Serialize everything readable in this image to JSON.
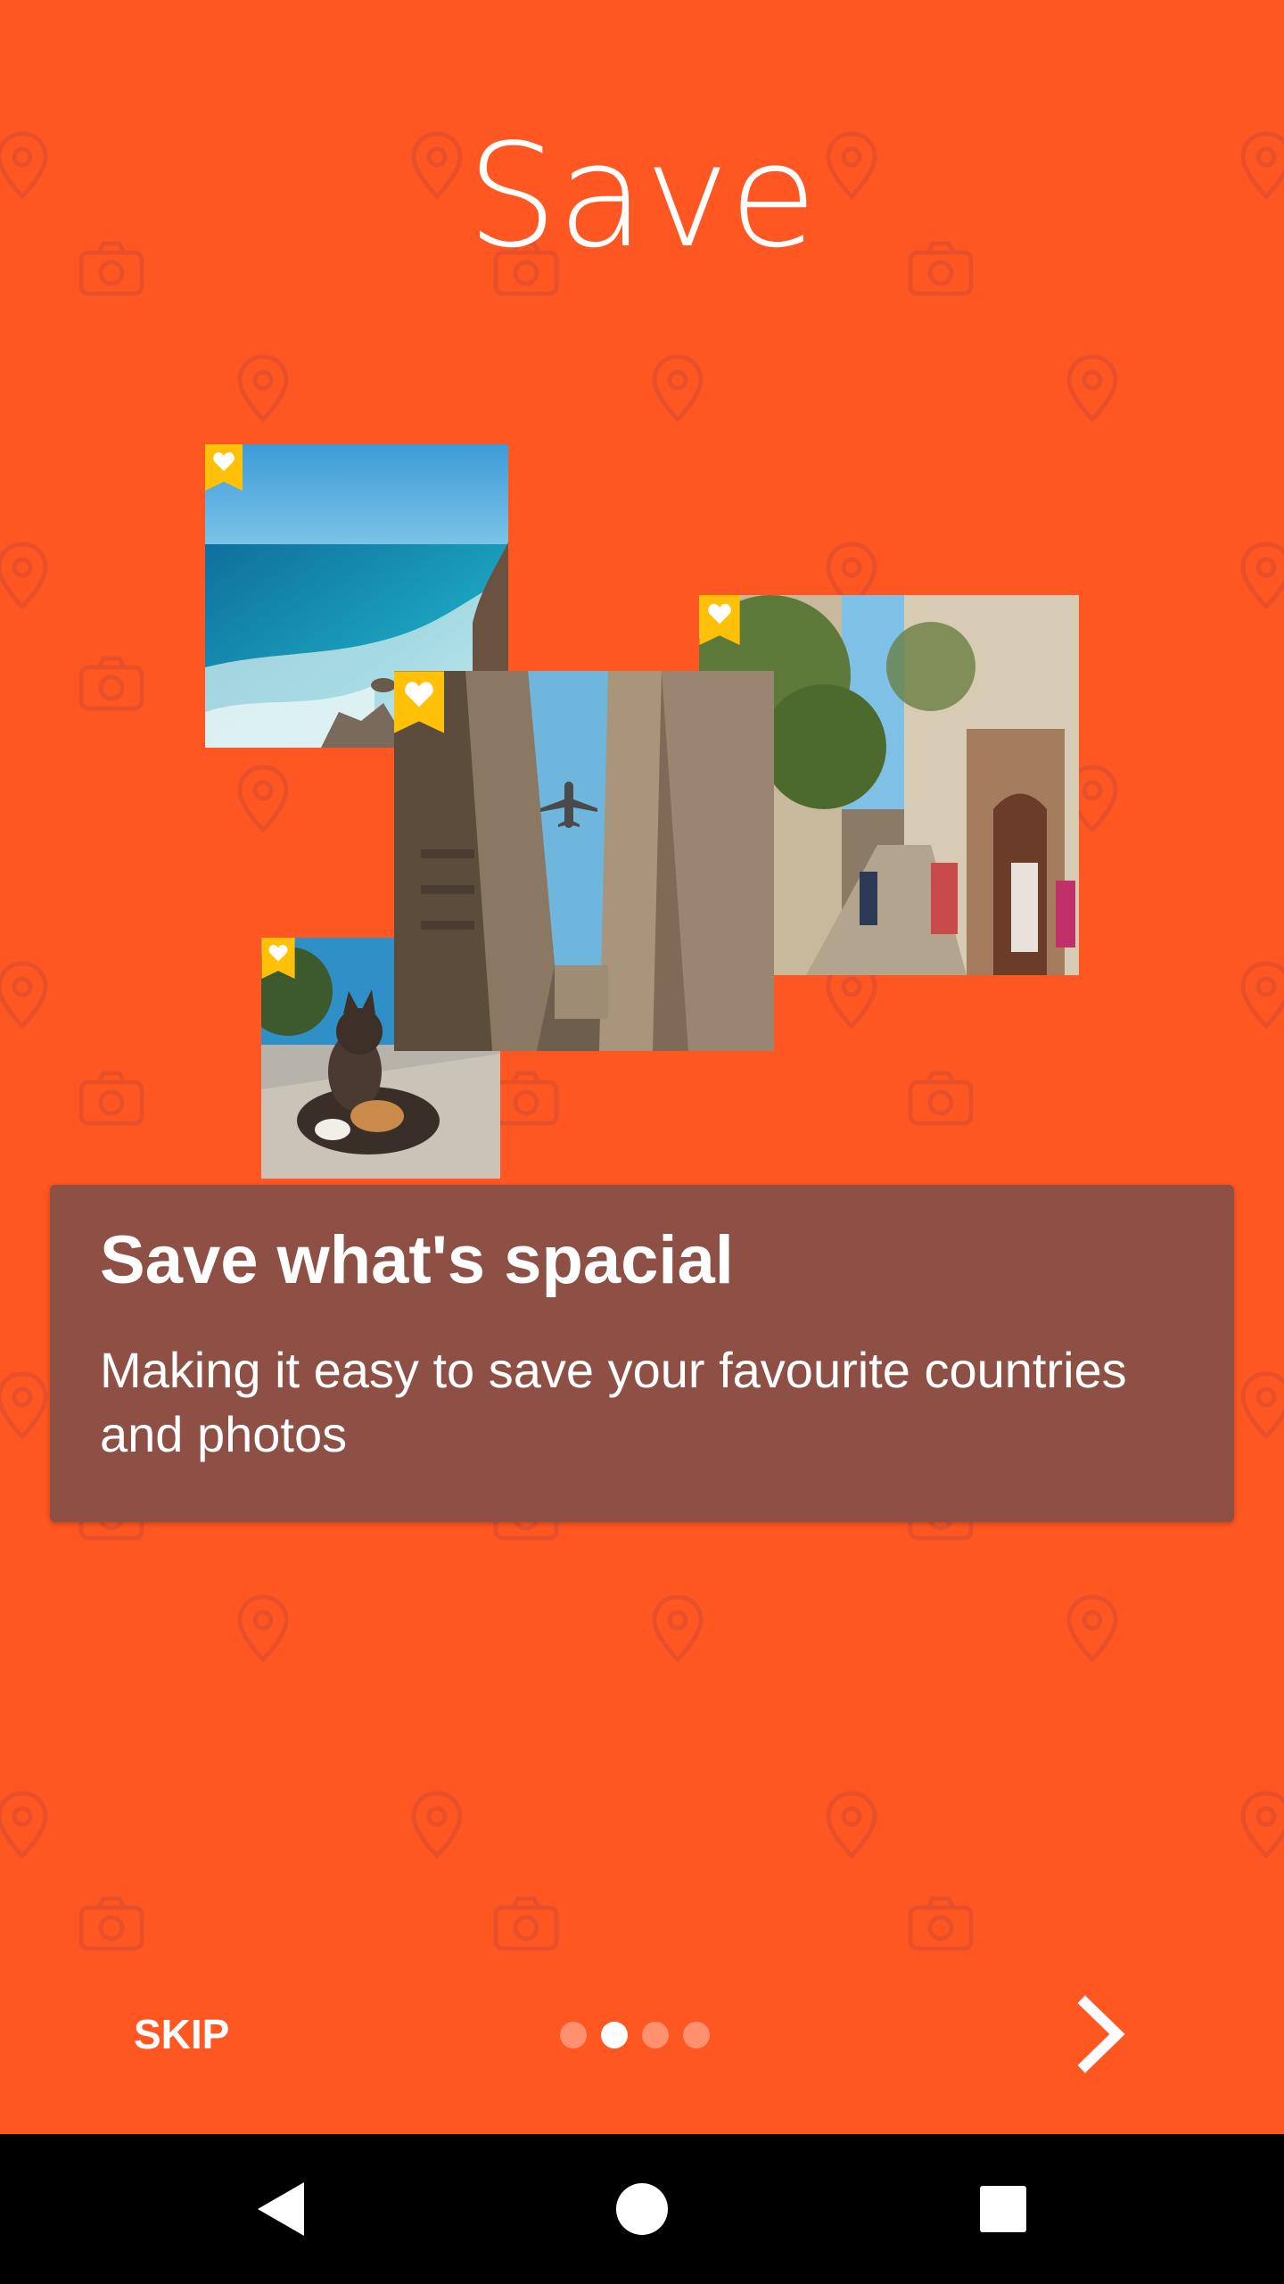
{
  "page": {
    "title": "Save"
  },
  "card": {
    "title": "Save what's spacial",
    "text": "Making it easy to save your favourite countries and photos"
  },
  "footer": {
    "skip_label": "SKIP",
    "pager": {
      "total": 4,
      "active_index": 1
    }
  },
  "icons": {
    "next": "chevron-right-icon",
    "favorite": "heart-bookmark-icon",
    "pattern": [
      "map-pin-icon",
      "camera-icon"
    ],
    "nav": [
      "back-icon",
      "home-icon",
      "recents-icon"
    ]
  },
  "photos": [
    {
      "name": "photo-ocean-coast",
      "favorited": true
    },
    {
      "name": "photo-street-alley",
      "favorited": true
    },
    {
      "name": "photo-airplane-buildings",
      "favorited": true
    },
    {
      "name": "photo-cat",
      "favorited": true
    }
  ],
  "colors": {
    "background": "#FF5722",
    "card": "#8E4F45",
    "ribbon": "#FFC107",
    "text": "#FFFFFF",
    "navbar": "#000000"
  }
}
